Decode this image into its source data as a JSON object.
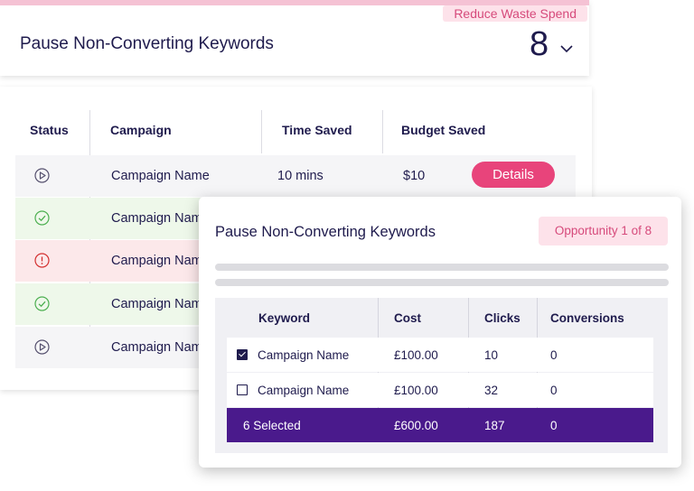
{
  "header": {
    "badge": "Reduce Waste Spend",
    "title": "Pause Non-Converting Keywords",
    "count": "8"
  },
  "table": {
    "columns": {
      "status": "Status",
      "campaign": "Campaign",
      "time_saved": "Time Saved",
      "budget_saved": "Budget Saved"
    },
    "rows": [
      {
        "status": "play-icon",
        "campaign": "Campaign Name",
        "time_saved": "10 mins",
        "budget_saved": "$10",
        "action": "Details"
      },
      {
        "status": "check-circle-icon",
        "campaign": "Campaign Name"
      },
      {
        "status": "alert-circle-icon",
        "campaign": "Campaign Name"
      },
      {
        "status": "check-circle-icon",
        "campaign": "Campaign Name"
      },
      {
        "status": "play-icon",
        "campaign": "Campaign Name"
      }
    ],
    "colors": {
      "success_bg": "#eef8ea",
      "error_bg": "#fce8ea",
      "neutral_bg": "#f5f5f7",
      "accent": "#e8447b"
    }
  },
  "overlay": {
    "title": "Pause Non-Converting Keywords",
    "badge": "Opportunity 1 of 8",
    "columns": {
      "keyword": "Keyword",
      "cost": "Cost",
      "clicks": "Clicks",
      "conversions": "Conversions"
    },
    "rows": [
      {
        "checked": true,
        "keyword": "Campaign Name",
        "cost": "£100.00",
        "clicks": "10",
        "conversions": "0"
      },
      {
        "checked": false,
        "keyword": "Campaign Name",
        "cost": "£100.00",
        "clicks": "32",
        "conversions": "0"
      }
    ],
    "total": {
      "label": "6 Selected",
      "cost": "£600.00",
      "clicks": "187",
      "conversions": "0"
    },
    "colors": {
      "total_bg": "#4a1a8c"
    }
  }
}
